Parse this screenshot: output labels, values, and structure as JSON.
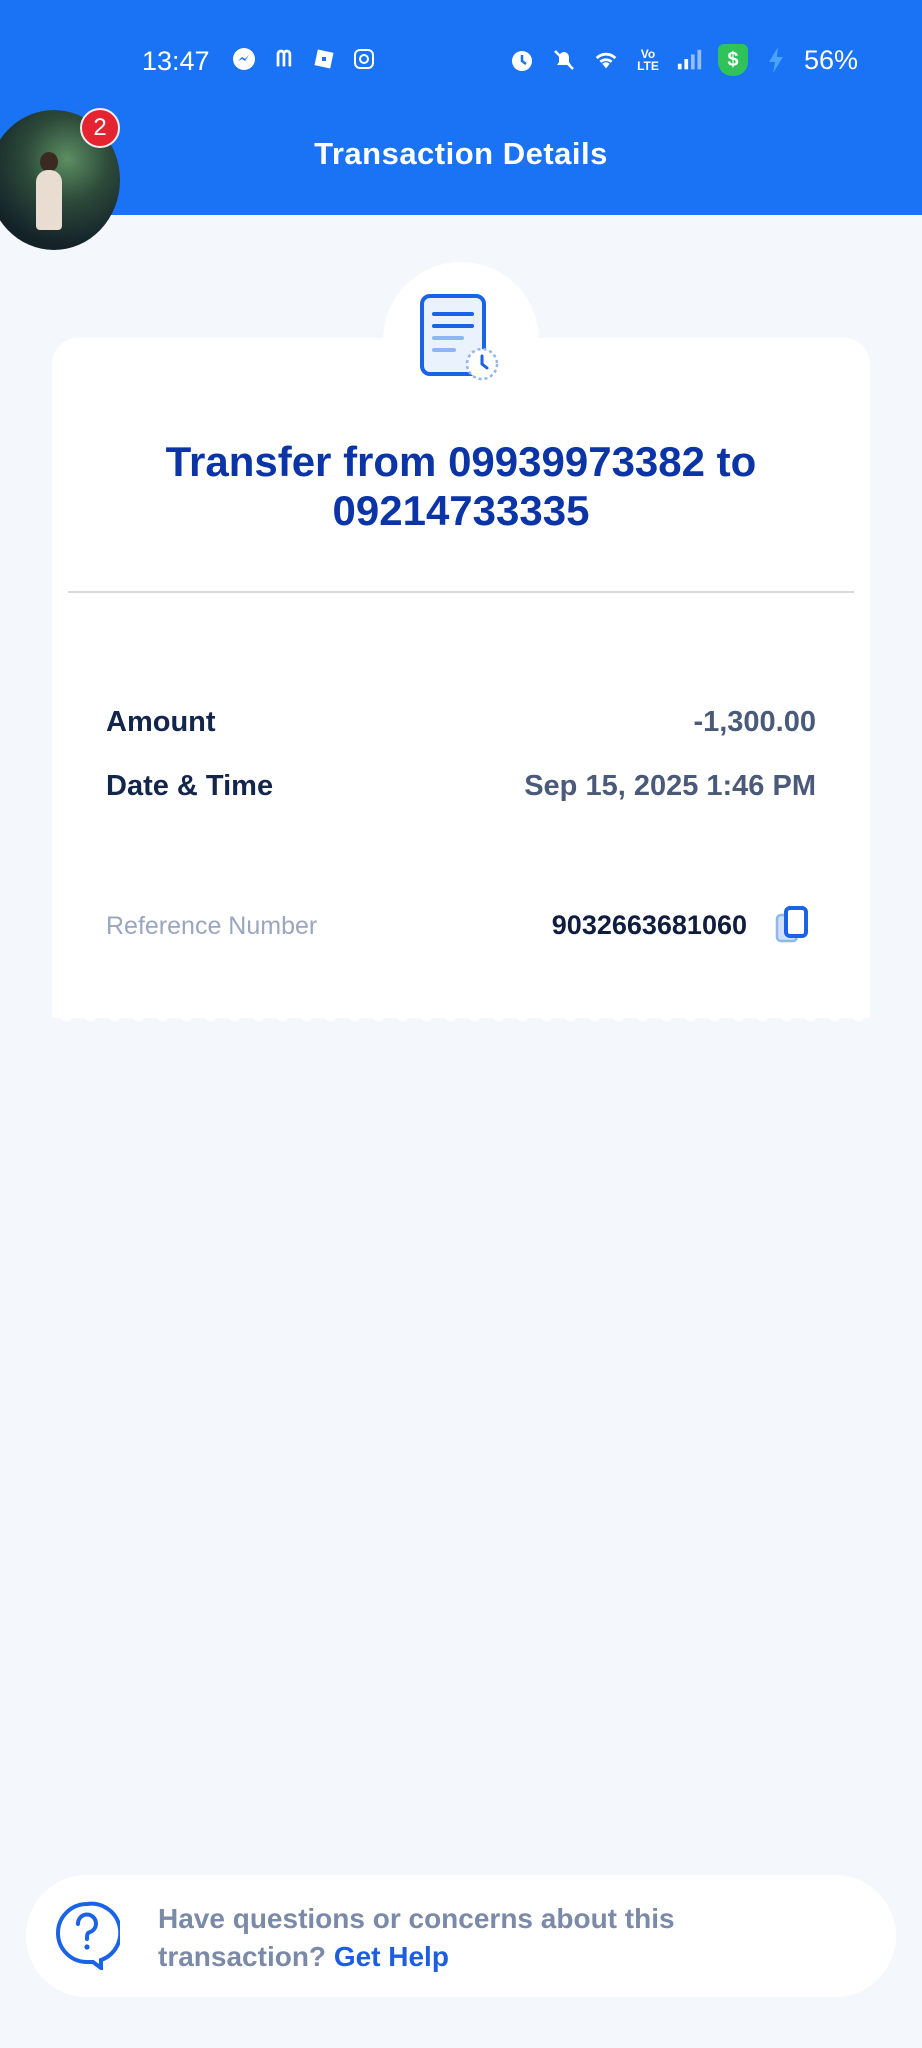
{
  "status_bar": {
    "time": "13:47",
    "battery": "56%",
    "app_icons": [
      "messenger-icon",
      "mcdonalds-icon",
      "roblox-icon",
      "instagram-icon"
    ]
  },
  "header": {
    "title": "Transaction Details",
    "notification_count": "2"
  },
  "transaction": {
    "title": "Transfer from 09939973382 to 09214733335",
    "amount_label": "Amount",
    "amount_value": "-1,300.00",
    "datetime_label": "Date & Time",
    "datetime_value": "Sep 15, 2025 1:46 PM",
    "reference_label": "Reference Number",
    "reference_value": "9032663681060"
  },
  "help": {
    "text": "Have questions or concerns about this transaction?",
    "link": "Get Help"
  },
  "colors": {
    "header": "#1a72f5",
    "title_blue": "#0b34a6",
    "background": "#f4f8fd",
    "link": "#1b5fe0"
  }
}
